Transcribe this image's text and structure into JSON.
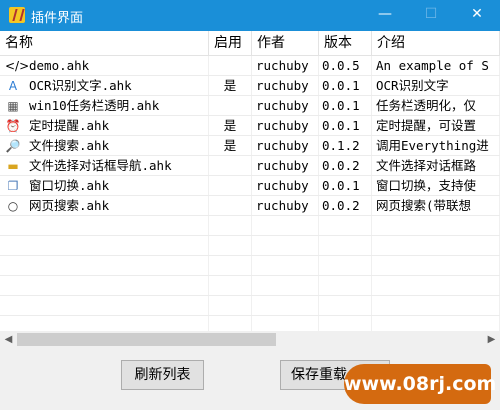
{
  "window": {
    "title": "插件界面",
    "minimize": "—",
    "maximize": "☐",
    "close": "✕"
  },
  "columns": [
    "名称",
    "启用",
    "作者",
    "版本",
    "介绍"
  ],
  "rows": [
    {
      "icon": "code-icon",
      "glyph": "</>",
      "color": "#000000",
      "name": "demo.ahk",
      "enabled": "",
      "author": "ruchuby",
      "version": "0.0.5",
      "desc": "An example of S"
    },
    {
      "icon": "ocr-icon",
      "glyph": "A",
      "color": "#2a7bd3",
      "name": "OCR识别文字.ahk",
      "enabled": "是",
      "author": "ruchuby",
      "version": "0.0.1",
      "desc": "OCR识别文字"
    },
    {
      "icon": "checkerboard-icon",
      "glyph": "▦",
      "color": "#555555",
      "name": "win10任务栏透明.ahk",
      "enabled": "",
      "author": "ruchuby",
      "version": "0.0.1",
      "desc": "任务栏透明化，仅"
    },
    {
      "icon": "alarm-clock-icon",
      "glyph": "⏰",
      "color": "#d07a10",
      "name": "定时提醒.ahk",
      "enabled": "是",
      "author": "ruchuby",
      "version": "0.0.1",
      "desc": "定时提醒，可设置"
    },
    {
      "icon": "search-key-icon",
      "glyph": "🔎",
      "color": "#c07010",
      "name": "文件搜索.ahk",
      "enabled": "是",
      "author": "ruchuby",
      "version": "0.1.2",
      "desc": "调用Everything进"
    },
    {
      "icon": "folder-icon",
      "glyph": "▬",
      "color": "#d9a520",
      "name": "文件选择对话框导航.ahk",
      "enabled": "",
      "author": "ruchuby",
      "version": "0.0.2",
      "desc": "文件选择对话框路"
    },
    {
      "icon": "window-switch-icon",
      "glyph": "❐",
      "color": "#4a7ab8",
      "name": "窗口切换.ahk",
      "enabled": "",
      "author": "ruchuby",
      "version": "0.0.1",
      "desc": "窗口切换，支持使"
    },
    {
      "icon": "magnifier-icon",
      "glyph": "○",
      "color": "#333333",
      "name": "网页搜索.ahk",
      "enabled": "",
      "author": "ruchuby",
      "version": "0.0.2",
      "desc": "网页搜索(带联想"
    }
  ],
  "buttons": {
    "refresh": "刷新列表",
    "save": "保存重载"
  },
  "watermark": "www.08rj.com"
}
